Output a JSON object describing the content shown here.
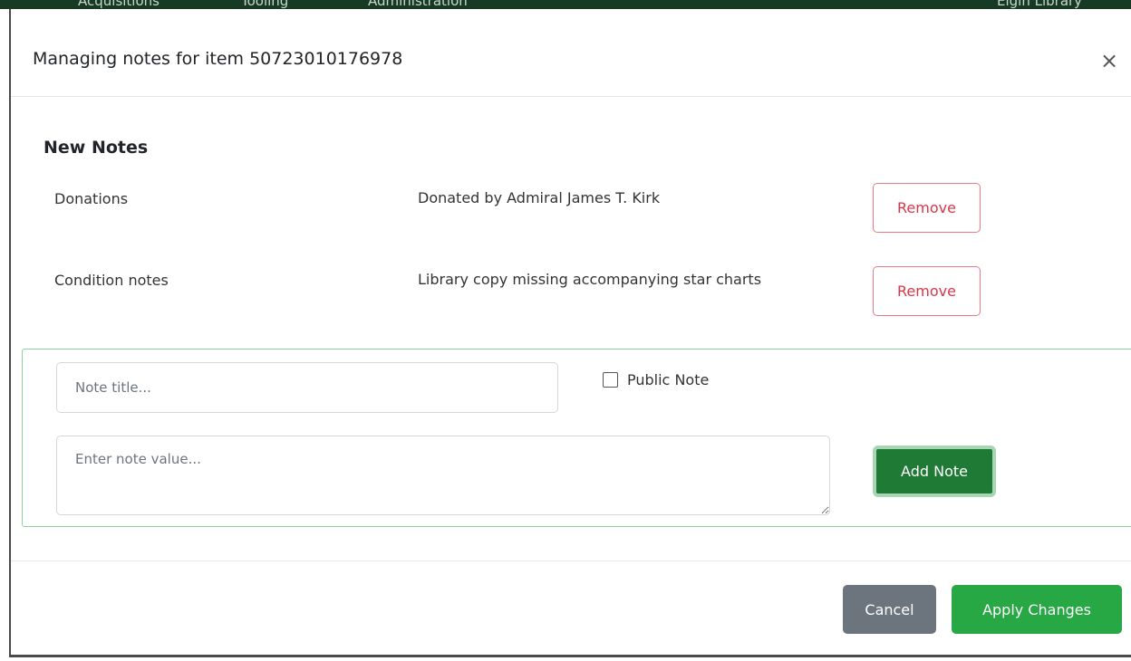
{
  "backdrop": {
    "nav_items": [
      "Acquisitions",
      "Tooling",
      "Administration",
      "Elgin Library"
    ]
  },
  "modal": {
    "title": "Managing notes for item 50723010176978",
    "close_label": "×"
  },
  "new_notes": {
    "heading": "New Notes",
    "items": [
      {
        "title": "Donations",
        "value": "Donated by Admiral James T. Kirk",
        "remove_label": "Remove"
      },
      {
        "title": "Condition notes",
        "value": "Library copy missing accompanying star charts",
        "remove_label": "Remove"
      }
    ]
  },
  "form": {
    "title_placeholder": "Note title...",
    "value_placeholder": "Enter note value...",
    "public_note_label": "Public Note",
    "public_note_checked": false,
    "add_label": "Add Note"
  },
  "footer": {
    "cancel_label": "Cancel",
    "apply_label": "Apply Changes"
  },
  "colors": {
    "primary_green": "#28a745",
    "dark_green": "#1e7a34",
    "danger": "#d9364a",
    "secondary": "#6c757d"
  }
}
